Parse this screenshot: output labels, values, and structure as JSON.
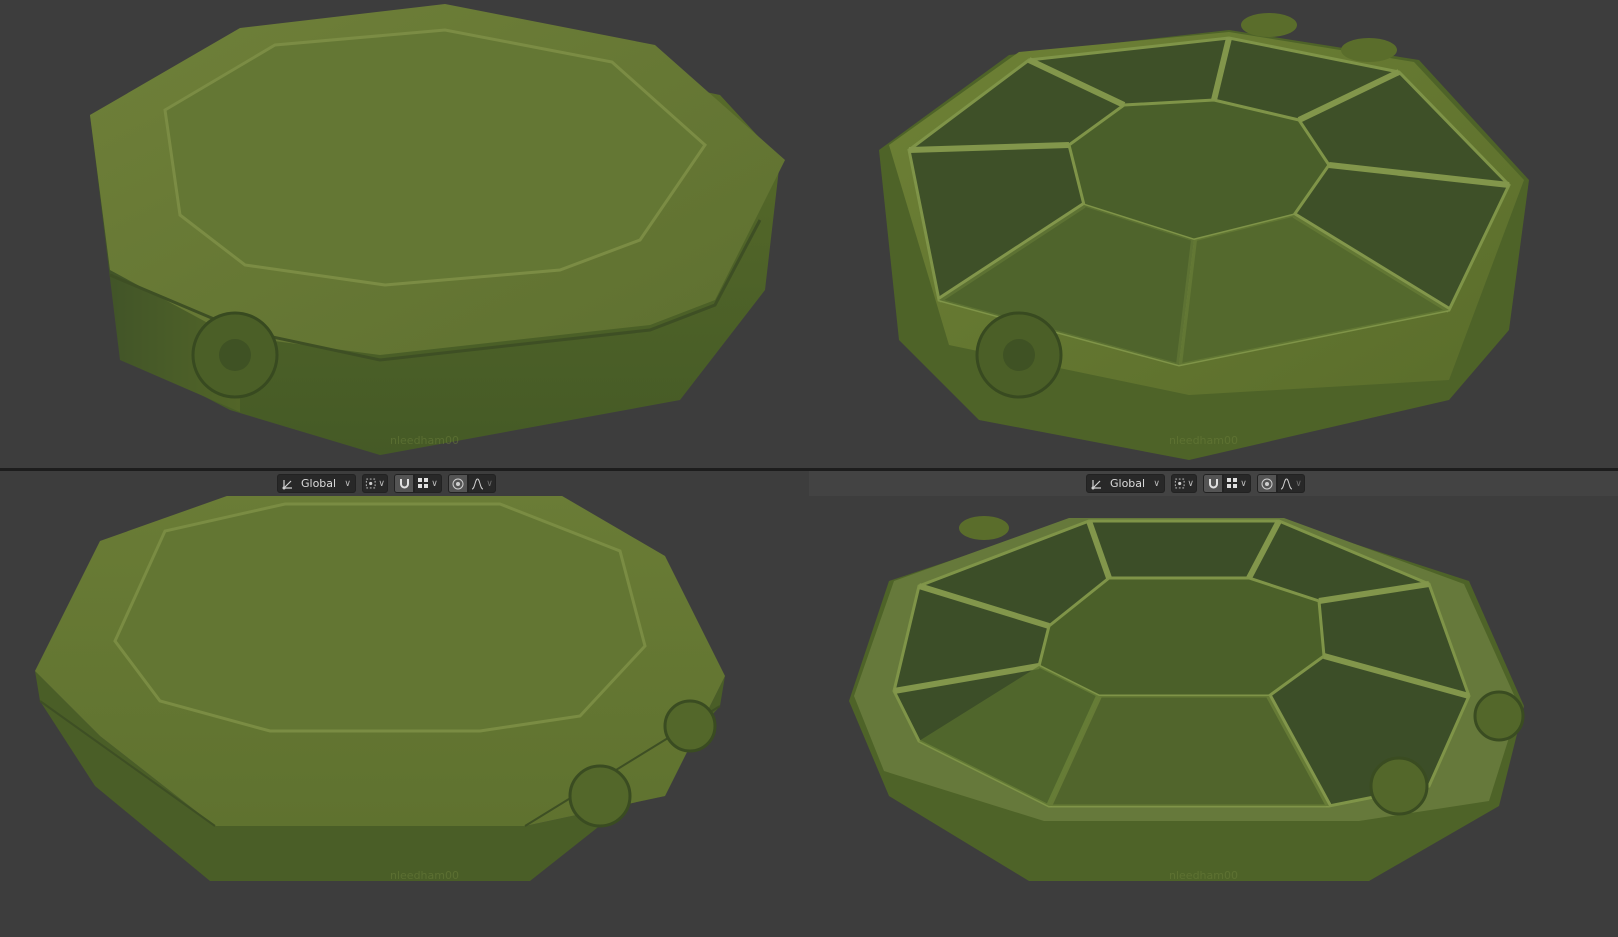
{
  "toolbar_left": {
    "orientation": "Global"
  },
  "toolbar_right": {
    "orientation": "Global"
  },
  "watermark": "nleedham00",
  "colors": {
    "background": "#3d3d3d",
    "model_light": "#6b7d36",
    "model_mid": "#56692a",
    "model_dark": "#3d4f22"
  },
  "icons": [
    "transform-orientation-icon",
    "pivot-point-icon",
    "snap-magnet-icon",
    "snap-grid-icon",
    "proportional-edit-icon",
    "falloff-curve-icon"
  ]
}
